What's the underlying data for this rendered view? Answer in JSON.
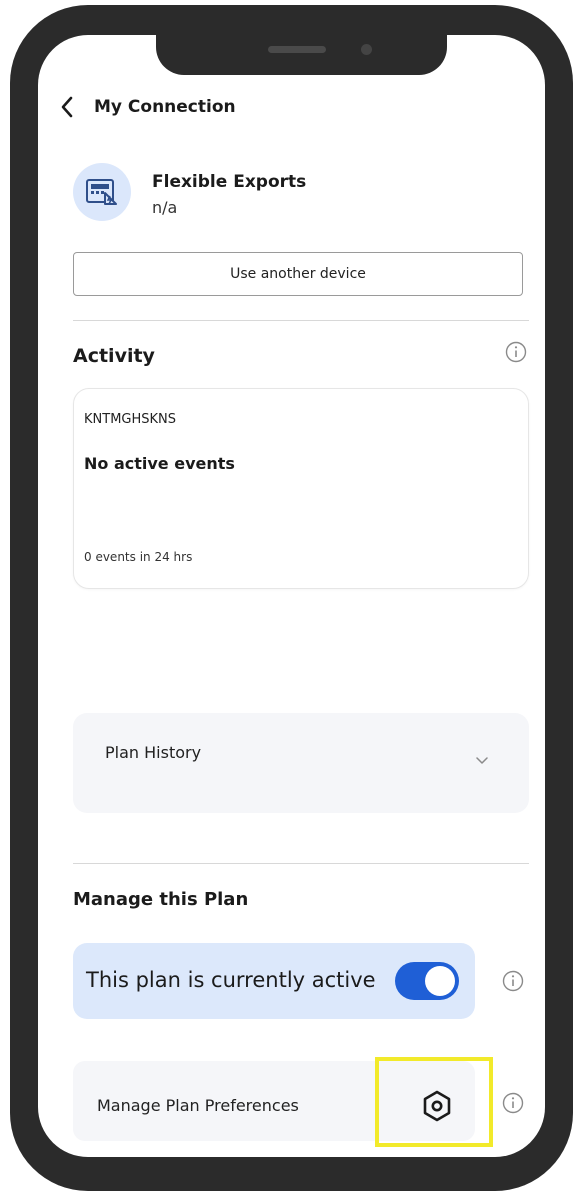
{
  "header": {
    "title": "My Connection"
  },
  "device": {
    "name": "Flexible Exports",
    "subtitle": "n/a",
    "icon": "meter-icon"
  },
  "actions": {
    "use_another_device": "Use another device"
  },
  "activity": {
    "title": "Activity",
    "code": "KNTMGHSKNS",
    "status": "No active events",
    "count": "0 events in 24 hrs"
  },
  "plan_history": {
    "label": "Plan History"
  },
  "manage": {
    "title": "Manage this Plan",
    "active_label": "This plan is currently active",
    "active_toggle_on": true,
    "preferences_label": "Manage Plan Preferences"
  },
  "colors": {
    "accent": "#1f5fd6",
    "active_bg": "#dce8fb",
    "highlight": "#f2ea2a",
    "frame": "#2b2b2b"
  }
}
